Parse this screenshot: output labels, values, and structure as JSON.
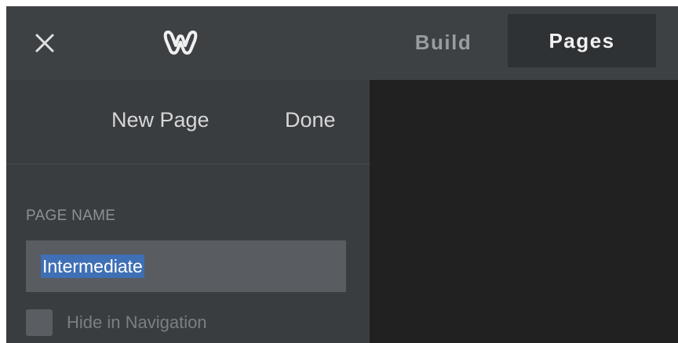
{
  "topbar": {
    "close_icon": "close-icon",
    "logo_icon": "weebly-logo-icon",
    "tabs": [
      {
        "label": "Build",
        "active": false
      },
      {
        "label": "Pages",
        "active": true
      }
    ]
  },
  "panel": {
    "new_page_label": "New Page",
    "done_label": "Done",
    "page_name_label": "PAGE NAME",
    "page_name_value": "Intermediate",
    "hide_in_navigation_label": "Hide in Navigation",
    "hide_in_navigation_checked": false
  },
  "colors": {
    "topbar_bg": "#3e4144",
    "active_tab_bg": "#2f3234",
    "panel_bg": "#3a3d40",
    "input_bg": "#595c60",
    "selection": "#3f6fb5",
    "preview_bg": "#212121"
  }
}
